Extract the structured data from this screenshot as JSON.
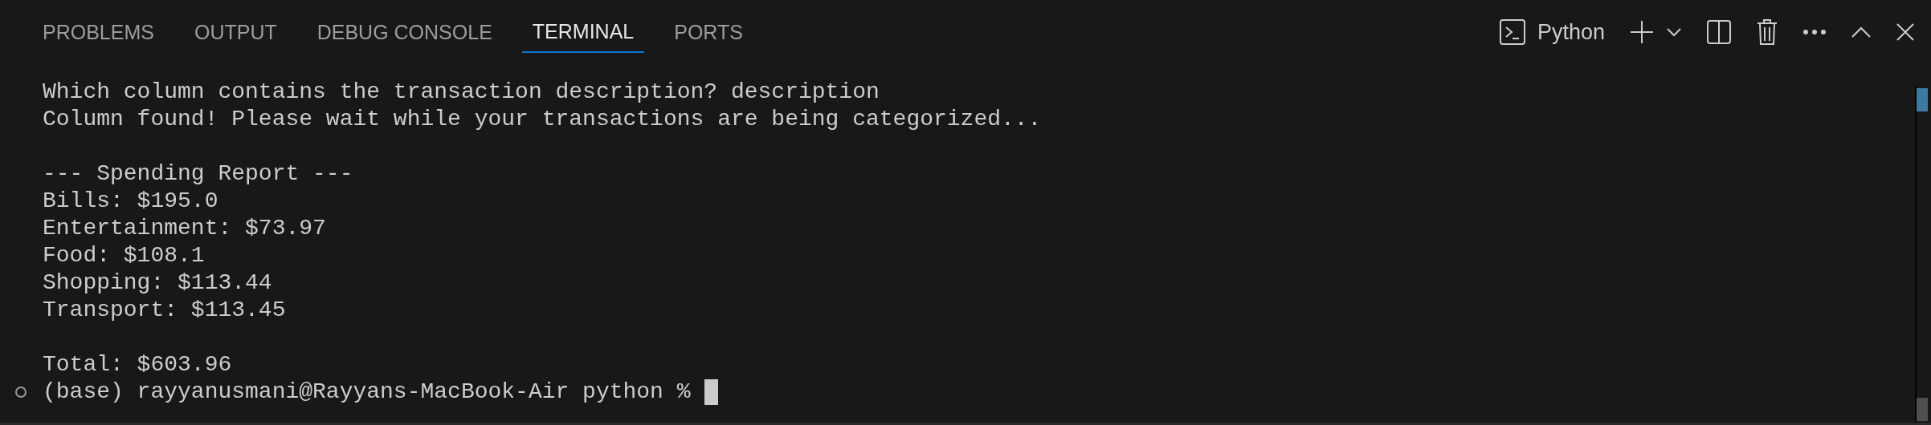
{
  "tabs": [
    {
      "label": "PROBLEMS",
      "selected": false
    },
    {
      "label": "OUTPUT",
      "selected": false
    },
    {
      "label": "DEBUG CONSOLE",
      "selected": false
    },
    {
      "label": "TERMINAL",
      "selected": true
    },
    {
      "label": "PORTS",
      "selected": false
    }
  ],
  "terminal_profile": "Python",
  "output_blocks": [
    [
      "Which column contains the transaction description? description",
      "Column found! Please wait while your transactions are being categorized..."
    ],
    [
      "--- Spending Report ---",
      "Bills: $195.0",
      "Entertainment: $73.97",
      "Food: $108.1",
      "Shopping: $113.44",
      "Transport: $113.45"
    ],
    [
      "Total: $603.96"
    ]
  ],
  "prompt": "(base) rayyanusmani@Rayyans-MacBook-Air python %"
}
